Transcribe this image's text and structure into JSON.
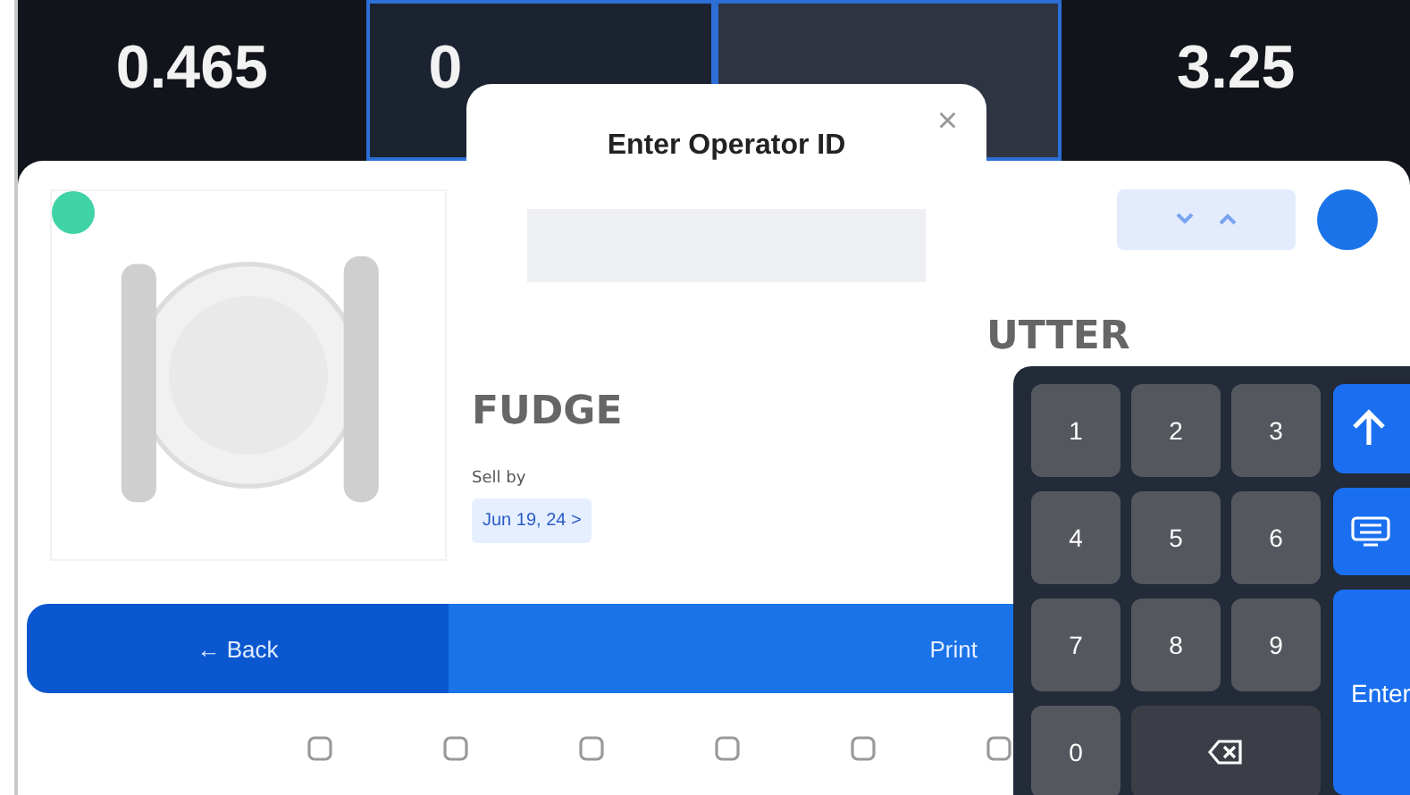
{
  "readouts": [
    {
      "value": "0.465",
      "highlighted": false
    },
    {
      "value": "0",
      "highlighted": true
    },
    {
      "highlighted": true
    },
    {
      "value": "3.25",
      "highlighted": false
    }
  ],
  "product": {
    "name_line_1": "UTTER",
    "name_line_2": "FUDGE",
    "sell_by_label": "Sell by",
    "sell_by_date": "Jun 19, 24 >"
  },
  "actions": [
    {
      "label": "← Back",
      "kind": "back"
    },
    {
      "label": "Print",
      "kind": "print"
    }
  ],
  "dialog": {
    "title": "Enter Operator ID",
    "close": "×"
  },
  "keypad": {
    "keys": [
      "1",
      "2",
      "3",
      "4",
      "5",
      "6",
      "7",
      "8",
      "9",
      "0"
    ],
    "enter": "Enter"
  }
}
